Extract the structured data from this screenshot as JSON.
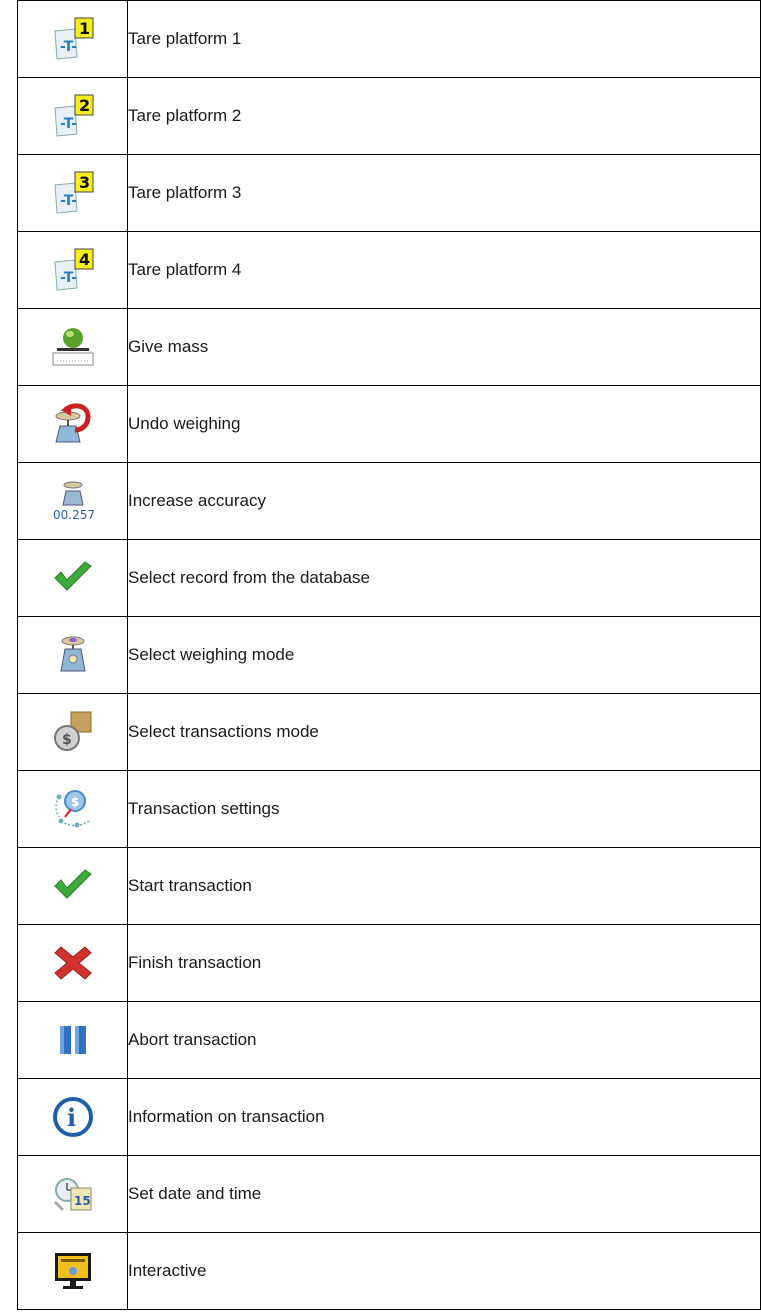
{
  "rows": [
    {
      "icon": "tare-platform-1-icon",
      "label": "Tare platform 1",
      "badge": "1"
    },
    {
      "icon": "tare-platform-2-icon",
      "label": "Tare platform 2",
      "badge": "2"
    },
    {
      "icon": "tare-platform-3-icon",
      "label": "Tare platform 3",
      "badge": "3"
    },
    {
      "icon": "tare-platform-4-icon",
      "label": "Tare platform 4",
      "badge": "4"
    },
    {
      "icon": "give-mass-icon",
      "label": "Give mass"
    },
    {
      "icon": "undo-weighing-icon",
      "label": "Undo weighing"
    },
    {
      "icon": "increase-accuracy-icon",
      "label": "Increase accuracy",
      "readout": "00.257"
    },
    {
      "icon": "checkmark-icon",
      "label": "Select record from the database"
    },
    {
      "icon": "weighing-mode-scale-icon",
      "label": "Select weighing mode"
    },
    {
      "icon": "transactions-mode-coin-icon",
      "label": "Select transactions mode"
    },
    {
      "icon": "transaction-settings-icon",
      "label": "Transaction settings"
    },
    {
      "icon": "checkmark-icon",
      "label": "Start transaction"
    },
    {
      "icon": "cross-icon",
      "label": "Finish transaction"
    },
    {
      "icon": "pause-icon",
      "label": "Abort transaction"
    },
    {
      "icon": "info-icon",
      "label": "Information on transaction"
    },
    {
      "icon": "date-time-calendar-icon",
      "label": "Set date and time",
      "badge": "15"
    },
    {
      "icon": "interactive-monitor-icon",
      "label": "Interactive"
    }
  ]
}
